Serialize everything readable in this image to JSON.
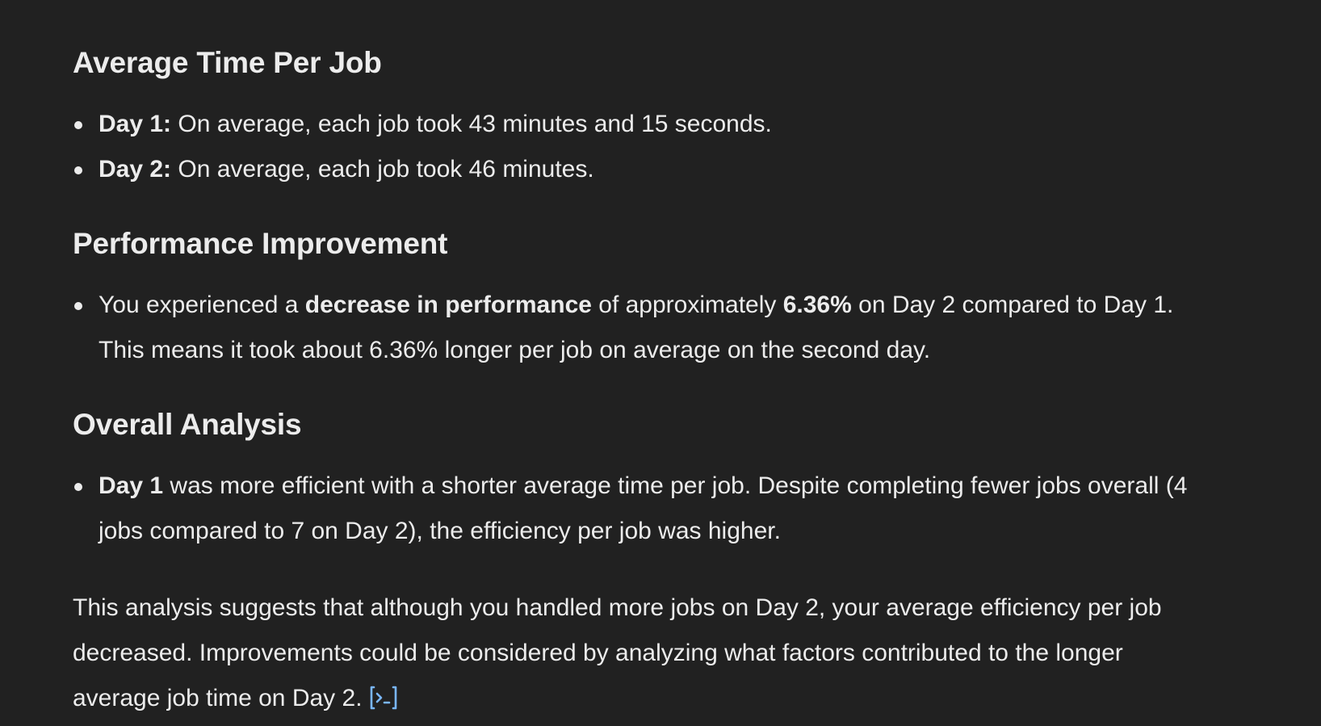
{
  "sections": {
    "avg_time": {
      "title": "Average Time Per Job",
      "items": [
        {
          "label": "Day 1:",
          "text": " On average, each job took 43 minutes and 15 seconds."
        },
        {
          "label": "Day 2:",
          "text": " On average, each job took 46 minutes."
        }
      ]
    },
    "performance": {
      "title": "Performance Improvement",
      "item": {
        "t1": "You experienced a ",
        "b1": "decrease in performance",
        "t2": " of approximately ",
        "b2": "6.36%",
        "t3": " on Day 2 compared to Day 1. This means it took about 6.36% longer per job on average on the second day."
      }
    },
    "overall": {
      "title": "Overall Analysis",
      "item": {
        "label": "Day 1",
        "text": " was more efficient with a shorter average time per job. Despite completing fewer jobs overall (4 jobs compared to 7 on Day 2), the efficiency per job was higher."
      }
    }
  },
  "summary": {
    "text": "This analysis suggests that although you handled more jobs on Day 2, your average efficiency per job decreased. Improvements could be considered by analyzing what factors contributed to the longer average job time on Day 2."
  },
  "icons": {
    "code_link": "code-interpreter-link-icon",
    "code_link_color": "#7ab7ff"
  }
}
